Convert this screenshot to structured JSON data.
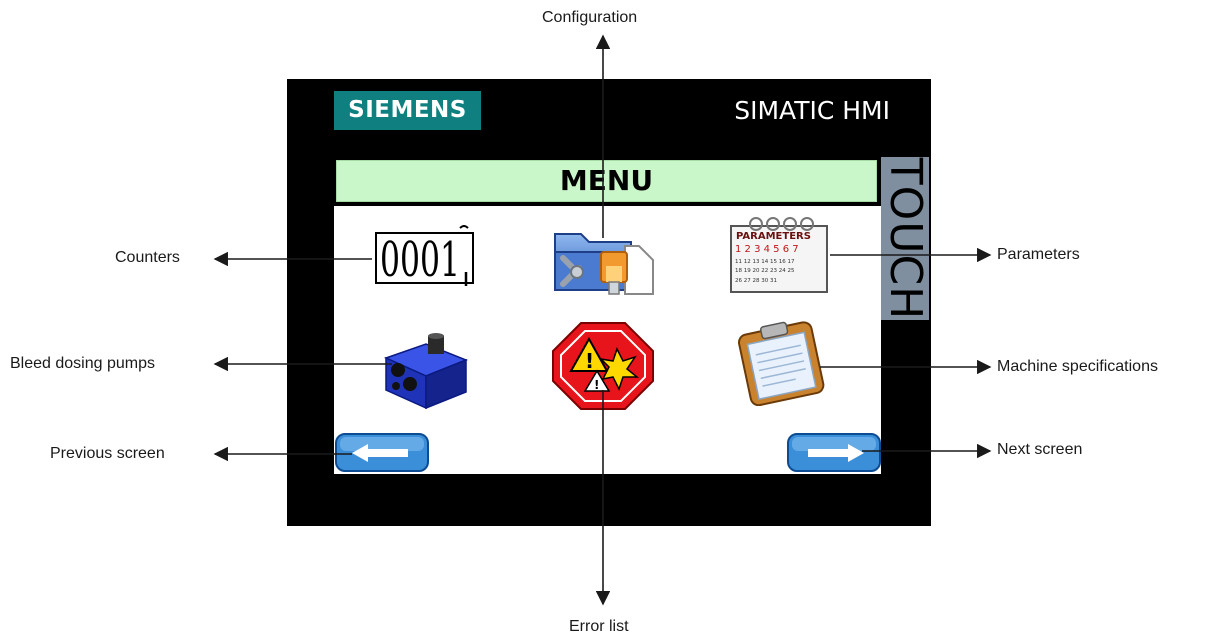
{
  "hmi": {
    "brand": "SIEMENS",
    "product": "SIMATIC HMI",
    "side_label": "TOUCH",
    "screen_title": "MENU"
  },
  "icons": {
    "counter_digits": "0001",
    "calendar_title": "PARAMETERS",
    "calendar_digits": "1 2 3 4 5 6 7",
    "calendar_row1": "11 12 13 14 15 16 17",
    "calendar_row2": "18 19 20 22 23 24 25",
    "calendar_row3": "26 27 28 30 31"
  },
  "callouts": {
    "configuration": "Configuration",
    "counters": "Counters",
    "parameters": "Parameters",
    "bleed_dosing_pumps": "Bleed dosing pumps",
    "machine_specifications": "Machine specifications",
    "previous_screen": "Previous screen",
    "next_screen": "Next screen",
    "error_list": "Error list"
  },
  "colors": {
    "frame": "#000000",
    "brand_bg": "#0f7f7f",
    "menu_bar": "#c9f7c9",
    "touch_strip": "#7f8f9f",
    "nav_button": "#3b8fd8",
    "error_octagon": "#e8141b"
  }
}
